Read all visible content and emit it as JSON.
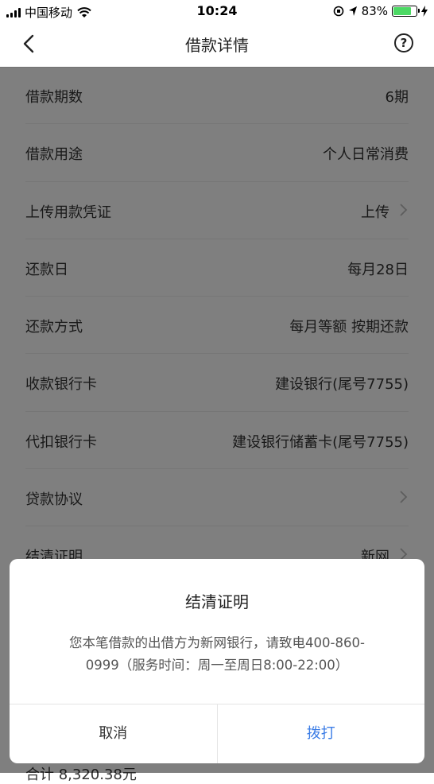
{
  "status_bar": {
    "carrier": "中国移动",
    "time": "10:24",
    "battery_percent": "83%",
    "battery_level": 0.83
  },
  "nav": {
    "title": "借款详情",
    "back_icon": "chevron-left-icon",
    "help_icon": "question-circle-icon",
    "help_glyph": "?"
  },
  "rows": [
    {
      "label": "借款期数",
      "value": "6期",
      "arrow": false
    },
    {
      "label": "借款用途",
      "value": "个人日常消费",
      "arrow": false
    },
    {
      "label": "上传用款凭证",
      "value": "上传",
      "arrow": true
    },
    {
      "label": "还款日",
      "value": "每月28日",
      "arrow": false
    },
    {
      "label": "还款方式",
      "value": "每月等额 按期还款",
      "arrow": false
    },
    {
      "label": "收款银行卡",
      "value": "建设银行(尾号7755)",
      "arrow": false
    },
    {
      "label": "代扣银行卡",
      "value": "建设银行储蓄卡(尾号7755)",
      "arrow": false
    },
    {
      "label": "贷款协议",
      "value": "",
      "arrow": true
    },
    {
      "label": "结清证明",
      "value": "新网",
      "arrow": true
    }
  ],
  "peek_text": "合计 8,320.38元",
  "dialog": {
    "title": "结清证明",
    "message": "您本笔借款的出借方为新网银行，请致电400-860-0999（服务时间：周一至周日8:00-22:00）",
    "cancel_label": "取消",
    "call_label": "拨打"
  },
  "colors": {
    "accent": "#3c7de6",
    "overlay": "rgba(0,0,0,0.5)",
    "battery": "#4cd964"
  }
}
